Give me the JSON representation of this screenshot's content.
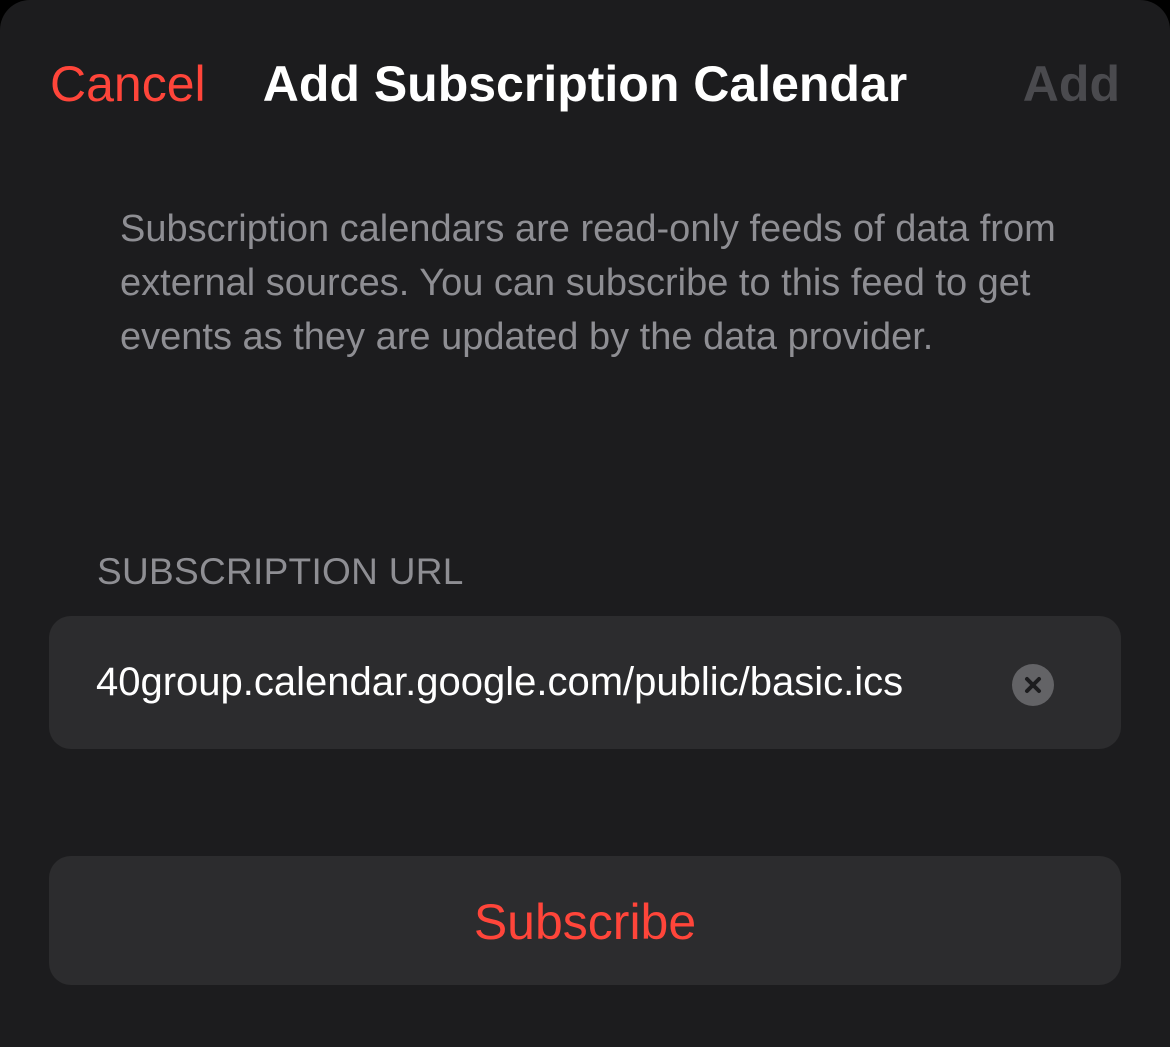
{
  "nav": {
    "cancel_label": "Cancel",
    "title": "Add Subscription Calendar",
    "add_label": "Add"
  },
  "description": "Subscription calendars are read-only feeds of data from external sources. You can subscribe to this feed to get events as they are updated by the data provider.",
  "subscription": {
    "section_header": "SUBSCRIPTION URL",
    "url_value": "40group.calendar.google.com/public/basic.ics",
    "clear_icon": "clear-icon"
  },
  "actions": {
    "subscribe_label": "Subscribe"
  },
  "colors": {
    "accent": "#ff453a",
    "background": "#1c1c1e",
    "field": "#2c2c2e",
    "secondary_text": "#8e8e93",
    "disabled": "#4a4a4e"
  }
}
